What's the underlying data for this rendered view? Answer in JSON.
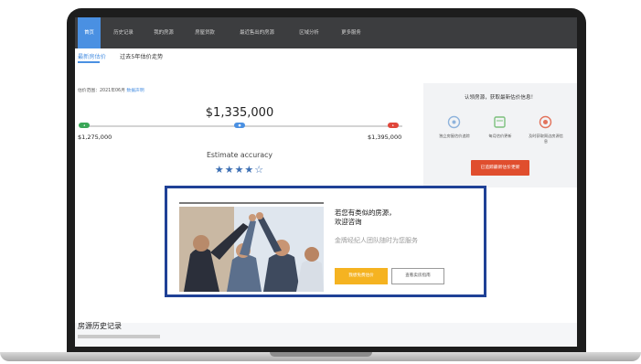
{
  "nav": {
    "tabs": [
      "首页",
      "历史记录",
      "我的房源",
      "房屋贷款",
      "最近售出的房源",
      "区域分析",
      "更多服务"
    ],
    "active_index": 0
  },
  "estimate": {
    "tabs": [
      "最新房估价",
      "过去5年估价走势"
    ],
    "range_date_prefix": "估价范围：2021年06月",
    "range_date_link": "数据声明",
    "price": "$1,335,000",
    "low_price": "$1,275,000",
    "high_price": "$1,395,000",
    "accuracy_label": "Estimate accuracy",
    "stars": "★★★★☆",
    "rating": 4,
    "rating_max": 5
  },
  "subscribe": {
    "title": "认领房源，获取最新估价信息！",
    "features": [
      "独立房屋估价追踪",
      "每月估价更新",
      "及时获取周边房源信息"
    ],
    "button": "已追踪最新估价更新"
  },
  "promo": {
    "title_line1": "若您有类似的房源，",
    "title_line2": "欢迎咨询",
    "subtitle": "金牌经纪人团队随时为您服务",
    "primary_button": "我想免费估价",
    "secondary_button": "查看卖房指南"
  },
  "history": {
    "title": "房源历史记录"
  },
  "colors": {
    "accent": "#4a90e2",
    "nav_bg": "#3c3d3f",
    "promo_border": "#1f4196",
    "promo_primary": "#f5b321",
    "subscribe_button": "#e04e2e"
  }
}
